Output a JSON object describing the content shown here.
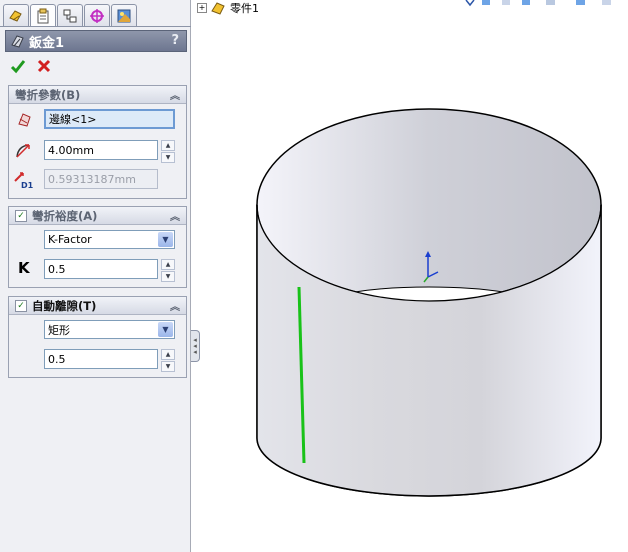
{
  "tabs": [
    {
      "icon": "feature-manager-icon"
    },
    {
      "icon": "property-manager-icon"
    },
    {
      "icon": "configuration-manager-icon"
    },
    {
      "icon": "dimxpert-icon"
    },
    {
      "icon": "display-manager-icon"
    }
  ],
  "property_manager": {
    "title": "鈑金1",
    "help": "?",
    "ok_icon": "checkmark-icon",
    "cancel_icon": "x-icon"
  },
  "bend_params": {
    "header": "彎折參數(B)",
    "edge_value": "邊線<1>",
    "radius_value": "4.00mm",
    "thickness_value": "0.59313187mm"
  },
  "bend_allowance": {
    "header": "彎折裕度(A)",
    "type_value": "K-Factor",
    "k_label": "K",
    "k_value": "0.5"
  },
  "auto_relief": {
    "header": "自動離隙(T)",
    "type_value": "矩形",
    "ratio_value": "0.5"
  },
  "tree": {
    "expander": "+",
    "part_label": "零件1"
  },
  "colors": {
    "accent_title": "#7a829a",
    "selected_edge": "#19c219",
    "cylinder_edge": "#000000"
  }
}
